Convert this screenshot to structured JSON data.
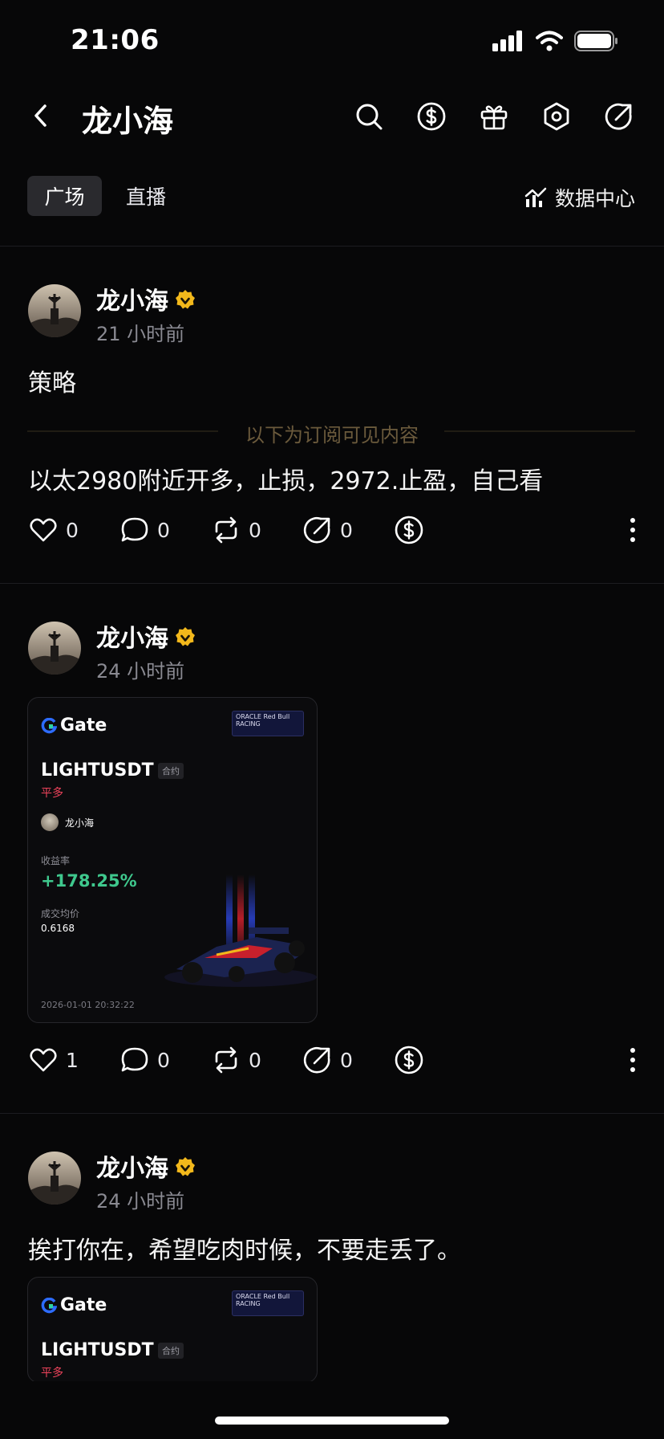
{
  "status": {
    "time": "21:06"
  },
  "header": {
    "title": "龙小海"
  },
  "tabs": [
    {
      "label": "广场",
      "active": true
    },
    {
      "label": "直播",
      "active": false
    }
  ],
  "data_center": {
    "label": "数据中心"
  },
  "posts": [
    {
      "author": "龙小海",
      "time": "21 小时前",
      "text": "策略",
      "locked_label": "以下为订阅可见内容",
      "locked_text": "以太2980附近开多，止损，2972.止盈，自己看",
      "likes": "0",
      "comments": "0",
      "reposts": "0",
      "shares": "0"
    },
    {
      "author": "龙小海",
      "time": "24 小时前",
      "card": {
        "brand": "Gate",
        "sponsor_text": "ORACLE Red Bull RACING",
        "pair": "LIGHTUSDT",
        "tag": "合约",
        "side": "平多",
        "user": "龙小海",
        "roi_label": "收益率",
        "roi": "+178.25%",
        "price_label": "成交均价",
        "price": "0.6168",
        "date": "2026-01-01 20:32:22"
      },
      "likes": "1",
      "comments": "0",
      "reposts": "0",
      "shares": "0"
    },
    {
      "author": "龙小海",
      "time": "24 小时前",
      "text": "挨打你在，希望吃肉时候，不要走丢了。",
      "card": {
        "brand": "Gate",
        "sponsor_text": "ORACLE Red Bull RACING",
        "pair": "LIGHTUSDT",
        "tag": "合约",
        "side": "平多"
      }
    }
  ],
  "colors": {
    "background": "#070708",
    "accent_gold": "#f2b81b",
    "profit_green": "#3fc88d",
    "short_red": "#f0445c"
  }
}
